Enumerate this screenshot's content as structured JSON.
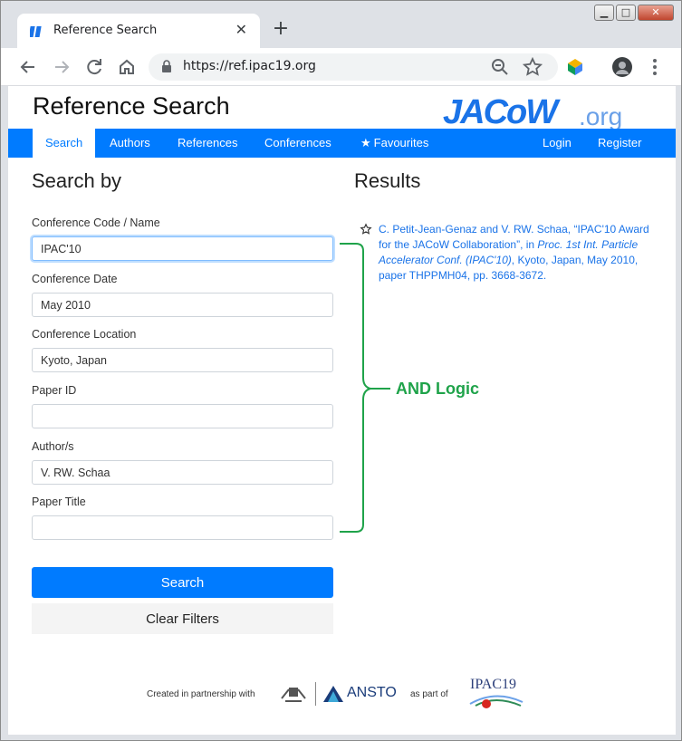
{
  "browser": {
    "tab_title": "Reference Search",
    "tab_close": "✕",
    "new_tab": "+",
    "url": "https://ref.ipac19.org",
    "window_minimize": "▁",
    "window_maximize": "□",
    "window_close": "✕"
  },
  "site": {
    "title": "Reference Search",
    "logo_main": "JACoW",
    "logo_suffix": ".org"
  },
  "nav": {
    "search": "Search",
    "authors": "Authors",
    "references": "References",
    "conferences": "Conferences",
    "favourites": "Favourites",
    "login": "Login",
    "register": "Register"
  },
  "search_panel": {
    "heading": "Search by",
    "fields": [
      {
        "label": "Conference Code / Name",
        "value": "IPAC'10"
      },
      {
        "label": "Conference Date",
        "value": "May 2010"
      },
      {
        "label": "Conference Location",
        "value": "Kyoto, Japan"
      },
      {
        "label": "Paper ID",
        "value": ""
      },
      {
        "label": "Author/s",
        "value": "V. RW. Schaa"
      },
      {
        "label": "Paper Title",
        "value": ""
      }
    ],
    "search_button": "Search",
    "clear_button": "Clear Filters"
  },
  "results": {
    "heading": "Results",
    "items": [
      {
        "prefix": "C. Petit-Jean-Genaz and V. RW. Schaa, “IPAC'10 Award for the JACoW Collaboration”, in ",
        "proceedings": "Proc. 1st Int. Particle Accelerator Conf. (IPAC'10)",
        "suffix": ", Kyoto, Japan, May 2010, paper THPPMH04, pp. 3668-3672."
      }
    ]
  },
  "annotation": {
    "label": "AND Logic",
    "color": "#1fa34a"
  },
  "footer": {
    "created_text": "Created in partnership with",
    "ansto": "ANSTO",
    "as_part_of": "as part of",
    "ipac": "IPAC19"
  },
  "colors": {
    "accent": "#007bff",
    "link": "#1a73e8"
  }
}
